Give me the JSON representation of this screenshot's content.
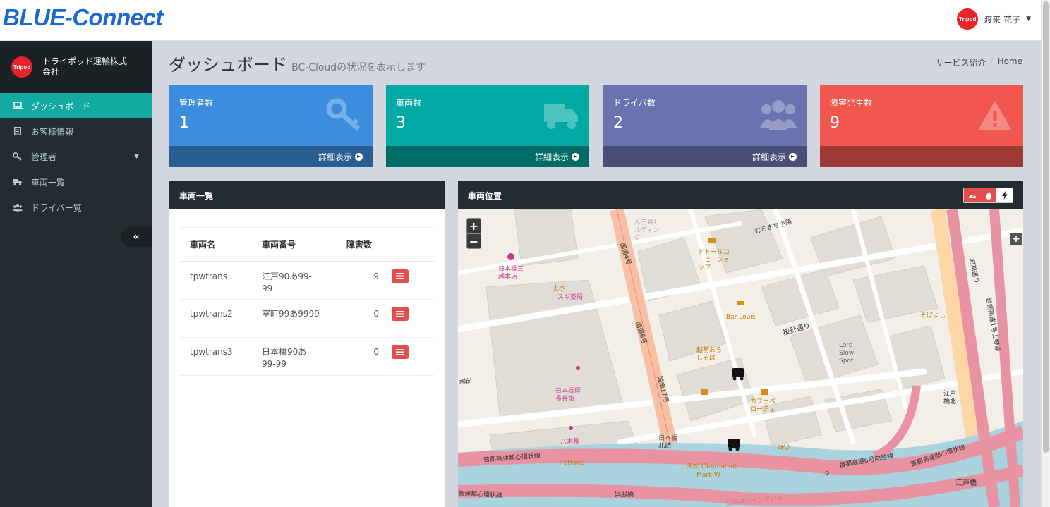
{
  "header": {
    "brand": "BLUE-Connect",
    "user_name": "渡来 花子",
    "avatar_text": "Tripod"
  },
  "sidebar": {
    "company_name": "トライポッド運輸株式会社",
    "company_logo_text": "Tripod",
    "items": [
      {
        "label": "ダッシュボード",
        "icon": "laptop-icon"
      },
      {
        "label": "お客様情報",
        "icon": "document-icon"
      },
      {
        "label": "管理者",
        "icon": "key-icon"
      },
      {
        "label": "車両一覧",
        "icon": "truck-icon"
      },
      {
        "label": "ドライバー覧",
        "icon": "users-icon"
      }
    ],
    "collapse_label": "«"
  },
  "page": {
    "title": "ダッシュボード",
    "subtitle": "BC-Cloudの状況を表示します",
    "breadcrumb": [
      "サービス紹介",
      "Home"
    ]
  },
  "stats": [
    {
      "label": "管理者数",
      "value": "1",
      "link": "詳細表示",
      "color": "#3c8dde",
      "foot_color": "#275d90"
    },
    {
      "label": "車両数",
      "value": "3",
      "link": "詳細表示",
      "color": "#00a9a3",
      "foot_color": "#006c66"
    },
    {
      "label": "ドライバ数",
      "value": "2",
      "link": "詳細表示",
      "color": "#6a73b0",
      "foot_color": "#484e75"
    },
    {
      "label": "障害発生数",
      "value": "9",
      "link": "",
      "color": "#f2574f",
      "foot_color": "#9e3a35"
    }
  ],
  "vehicle_panel": {
    "title": "車両一覧",
    "columns": [
      "車両名",
      "車両番号",
      "障害数"
    ],
    "rows": [
      {
        "name": "tpwtrans",
        "number": "江戸90あ99-99",
        "faults": "9"
      },
      {
        "name": "tpwtrans2",
        "number": "室町99あ9999",
        "faults": "0"
      },
      {
        "name": "tpwtrans3",
        "number": "日本橋90あ99-99",
        "faults": "0"
      }
    ]
  },
  "map_panel": {
    "title": "車両位置",
    "tools": [
      "speedometer-icon",
      "fire-icon",
      "bolt-icon"
    ],
    "labels": {
      "street1": "むろまち小路",
      "route4": "国道4号",
      "route6": "国道6号",
      "route17": "国道17号",
      "hariki": "按針通り",
      "mitsukoshi": "日本橋三越本店",
      "sugi": "スギ薬局",
      "suisui": "主水",
      "doutor": "ドトールコーヒーショップ",
      "barlouis": "Bar Louis",
      "echizen": "越前おろしそば",
      "loro": "Loro Slow Spot",
      "chobee": "日本橋屋長兵衛",
      "yagicho": "八木長",
      "trattoria": "Trattoria",
      "cafe": "カフェベローチェ",
      "tenmatsu": "天松 (Tenmatsu)",
      "markw": "Mark W",
      "yumaru": "由〇",
      "nihonbashi_kitazume": "日本橋北詰",
      "expressway_upper": "首都高速都心環状線",
      "expressway_lower": "高速都心環状線",
      "route6_mukojima": "首都高速6号向島線",
      "expressway_right": "首都高速都心環状線",
      "edobashi": "江戸橋",
      "edobashi_jc": "江戸橋ジャンクション",
      "showa": "昭和通り",
      "shuto1": "首都高速1号上野線",
      "sobayoshi": "そばよし",
      "route_no": "6",
      "hommachi": "越前",
      "mitsui": "ん三井ビルディング",
      "edobashi_kita": "江戸橋北",
      "gofukubashi": "呉服橋"
    }
  }
}
